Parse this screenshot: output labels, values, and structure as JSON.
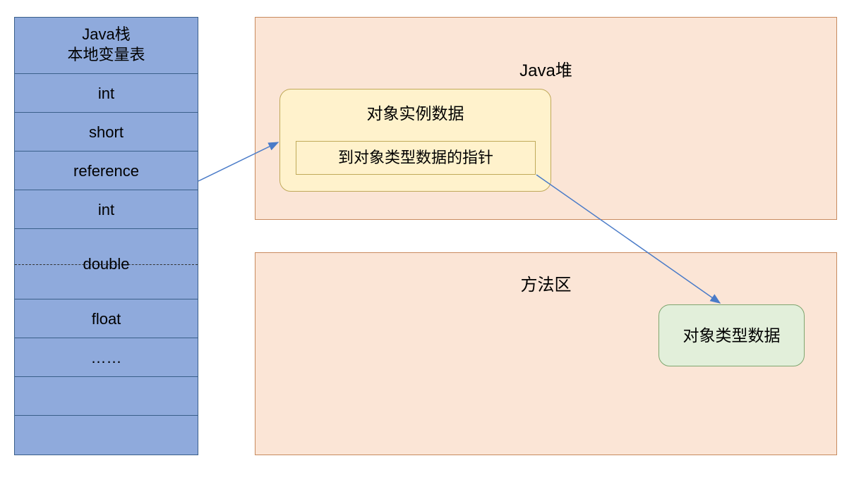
{
  "stack": {
    "title_line1": "Java栈",
    "title_line2": "本地变量表",
    "cells": [
      "int",
      "short",
      "reference",
      "int",
      "double",
      "float",
      "……",
      "",
      ""
    ]
  },
  "heap": {
    "title": "Java堆",
    "instance_title": "对象实例数据",
    "pointer_label": "到对象类型数据的指针"
  },
  "method_area": {
    "title": "方法区",
    "typedata_label": "对象类型数据"
  }
}
